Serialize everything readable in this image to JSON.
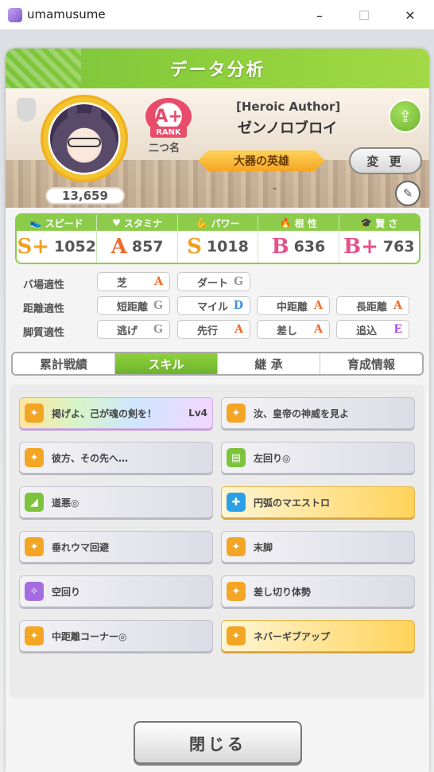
{
  "window": {
    "title": "umamusume",
    "minimize": "–",
    "maximize": "☐",
    "close": "✕"
  },
  "header": {
    "title": "データ分析"
  },
  "profile": {
    "score": "13,659",
    "rank": "A+",
    "rank_tag": "RANK",
    "nickname_label": "二つ名",
    "epithet": "[Heroic Author]",
    "name": "ゼンノロブロイ",
    "title_ribbon": "大器の英雄",
    "dash": "-",
    "change_label": "変 更"
  },
  "stats": [
    {
      "label": "スピード",
      "icon": "shoe-icon",
      "grade": "S+",
      "value": "1052",
      "color": "#f0a020"
    },
    {
      "label": "スタミナ",
      "icon": "heart-icon",
      "grade": "A",
      "value": "857",
      "color": "#ee6a2a"
    },
    {
      "label": "パワー",
      "icon": "muscle-icon",
      "grade": "S",
      "value": "1018",
      "color": "#f0a020"
    },
    {
      "label": "根 性",
      "icon": "flame-icon",
      "grade": "B",
      "value": "636",
      "color": "#e8508a"
    },
    {
      "label": "賢 さ",
      "icon": "graduation-icon",
      "grade": "B+",
      "value": "763",
      "color": "#e8508a"
    }
  ],
  "aptitudes": {
    "track": {
      "label": "バ場適性",
      "items": [
        {
          "name": "芝",
          "grade": "A"
        },
        {
          "name": "ダート",
          "grade": "G"
        }
      ]
    },
    "distance": {
      "label": "距離適性",
      "items": [
        {
          "name": "短距離",
          "grade": "G"
        },
        {
          "name": "マイル",
          "grade": "D"
        },
        {
          "name": "中距離",
          "grade": "A"
        },
        {
          "name": "長距離",
          "grade": "A"
        }
      ]
    },
    "style": {
      "label": "脚質適性",
      "items": [
        {
          "name": "逃げ",
          "grade": "G"
        },
        {
          "name": "先行",
          "grade": "A"
        },
        {
          "name": "差し",
          "grade": "A"
        },
        {
          "name": "追込",
          "grade": "E"
        }
      ]
    }
  },
  "grade_colors": {
    "A": "#ee6a2a",
    "G": "#9a9a9a",
    "D": "#3a8fe0",
    "E": "#b04ee0"
  },
  "tabs": [
    "累計戦績",
    "スキル",
    "継 承",
    "育成情報"
  ],
  "skills": [
    {
      "name": "掲げよ、己が魂の剣を！",
      "level": "Lv4",
      "style": "rainbow",
      "icon": "speed-skill-icon",
      "icon_color": "#f2a624"
    },
    {
      "name": "汝、皇帝の神威を見よ",
      "level": "",
      "style": "normal",
      "icon": "speed-skill-icon",
      "icon_color": "#f2a624"
    },
    {
      "name": "彼方、その先へ…",
      "level": "",
      "style": "normal",
      "icon": "speed-skill-icon",
      "icon_color": "#f2a624"
    },
    {
      "name": "左回り◎",
      "level": "",
      "style": "normal",
      "icon": "course-skill-icon",
      "icon_color": "#7cc43c"
    },
    {
      "name": "道悪◎",
      "level": "",
      "style": "normal",
      "icon": "power-skill-icon",
      "icon_color": "#7cc43c"
    },
    {
      "name": "円弧のマエストロ",
      "level": "",
      "style": "gold",
      "icon": "recovery-skill-icon",
      "icon_color": "#2aa0e8"
    },
    {
      "name": "垂れウマ回避",
      "level": "",
      "style": "normal",
      "icon": "speed-skill-icon",
      "icon_color": "#f2a624"
    },
    {
      "name": "末脚",
      "level": "",
      "style": "normal",
      "icon": "speed-skill-icon",
      "icon_color": "#f2a624"
    },
    {
      "name": "空回り",
      "level": "",
      "style": "normal",
      "icon": "debuff-skill-icon",
      "icon_color": "#a46ce0"
    },
    {
      "name": "差し切り体勢",
      "level": "",
      "style": "normal",
      "icon": "speed-skill-icon",
      "icon_color": "#f2a624"
    },
    {
      "name": "中距離コーナー◎",
      "level": "",
      "style": "normal",
      "icon": "speed-skill-icon",
      "icon_color": "#f2a624"
    },
    {
      "name": "ネバーギブアップ",
      "level": "",
      "style": "gold",
      "icon": "speed-skill-icon",
      "icon_color": "#f2a624"
    }
  ],
  "close_label": "閉じる"
}
